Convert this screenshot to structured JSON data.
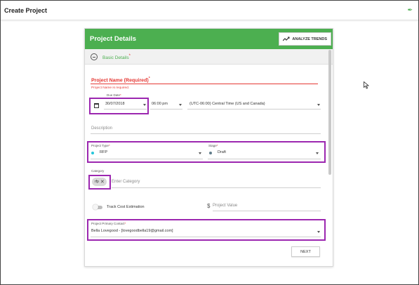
{
  "window": {
    "title": "Create Project"
  },
  "panel": {
    "title": "Project Details",
    "analyze_button": "ANALYZE TRENDS",
    "section_label": "Basic Details",
    "required_mark": "*"
  },
  "form": {
    "project_name": {
      "label": "Project Name (Required)",
      "required_mark": "*",
      "error": "Project Name is required."
    },
    "due_date": {
      "label": "Due Date",
      "required_mark": "*",
      "date": "30/07/2018",
      "time": "06:00 pm",
      "timezone": "(UTC-06:00) Central Time (US and Canada)"
    },
    "description": {
      "placeholder": "Description"
    },
    "project_type": {
      "label": "Project Type",
      "required_mark": "*",
      "value": "RFP"
    },
    "stage": {
      "label": "Stage",
      "required_mark": "*",
      "value": "Draft"
    },
    "category": {
      "label": "Category",
      "chip": "rfp",
      "placeholder": "Enter Category"
    },
    "track_cost": {
      "label": "Track Cost Estimation",
      "enabled": false
    },
    "project_value": {
      "currency": "$",
      "placeholder": "Project Value"
    },
    "primary_contact": {
      "label": "Project Primary Contact",
      "required_mark": "*",
      "value": "Bella Lovegood - [lovegoodbella19@gmail.com]"
    },
    "next_button": "NEXT"
  },
  "colors": {
    "header_green": "#4caf50",
    "error_red": "#e53935",
    "highlight_purple": "#9c27b0",
    "rfp_dot": "#26c6da",
    "draft_dot": "#607d8b"
  }
}
